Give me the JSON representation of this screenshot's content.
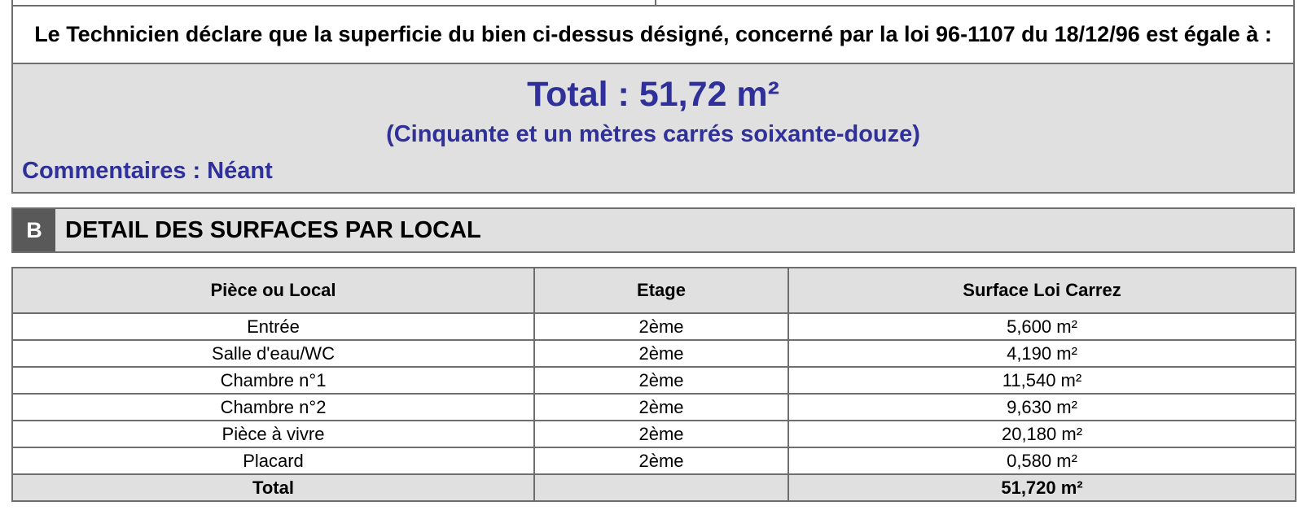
{
  "declaration": {
    "text": "Le Technicien déclare que la superficie du bien ci-dessus désigné, concerné par la loi 96-1107 du 18/12/96 est égale à :"
  },
  "summary": {
    "total_label": "Total : 51,72 m²",
    "total_words": "(Cinquante et un mètres carrés soixante-douze)",
    "comments_label": "Commentaires :",
    "comments_value": "Néant"
  },
  "section": {
    "letter": "B",
    "title": "DETAIL DES SURFACES PAR LOCAL"
  },
  "table": {
    "headers": [
      "Pièce ou Local",
      "Etage",
      "Surface Loi Carrez"
    ],
    "rows": [
      [
        "Entrée",
        "2ème",
        "5,600 m²"
      ],
      [
        "Salle d'eau/WC",
        "2ème",
        "4,190 m²"
      ],
      [
        "Chambre n°1",
        "2ème",
        "11,540 m²"
      ],
      [
        "Chambre n°2",
        "2ème",
        "9,630 m²"
      ],
      [
        "Pièce à vivre",
        "2ème",
        "20,180 m²"
      ],
      [
        "Placard",
        "2ème",
        "0,580 m²"
      ]
    ],
    "total_row": [
      "Total",
      "",
      "51,720 m²"
    ]
  },
  "colors": {
    "accent_text": "#30309a",
    "panel_gray": "#e0e0e0",
    "section_badge": "#595959",
    "border": "#6e6e6e"
  }
}
